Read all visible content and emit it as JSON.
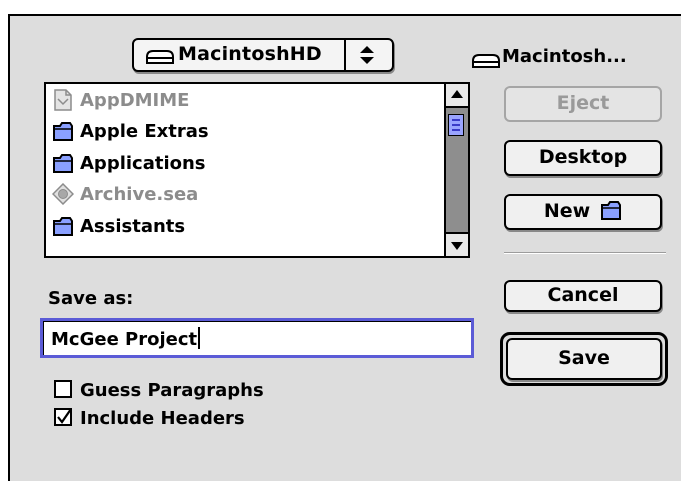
{
  "volume_popup": {
    "label": "MacintoshHD",
    "icon": "hard-disk-icon"
  },
  "disk_name": "Macintosh...",
  "files": [
    {
      "name": "AppDMIME",
      "icon": "document-icon",
      "enabled": false
    },
    {
      "name": "Apple Extras",
      "icon": "folder-icon",
      "enabled": true
    },
    {
      "name": "Applications",
      "icon": "folder-icon",
      "enabled": true
    },
    {
      "name": "Archive.sea",
      "icon": "archive-icon",
      "enabled": false
    },
    {
      "name": "Assistants",
      "icon": "folder-icon",
      "enabled": true
    }
  ],
  "buttons": {
    "eject": "Eject",
    "desktop": "Desktop",
    "new": "New",
    "cancel": "Cancel",
    "save": "Save"
  },
  "save_as_label": "Save as:",
  "save_as_value": "McGee Project",
  "options": [
    {
      "label": "Guess Paragraphs",
      "checked": false
    },
    {
      "label": "Include Headers",
      "checked": true
    }
  ],
  "colors": {
    "dialog_bg": "#dddddd",
    "focus_ring": "#5b5bd6",
    "scroll_thumb": "#9aa4ff",
    "disabled_text": "#8c8c8c"
  }
}
